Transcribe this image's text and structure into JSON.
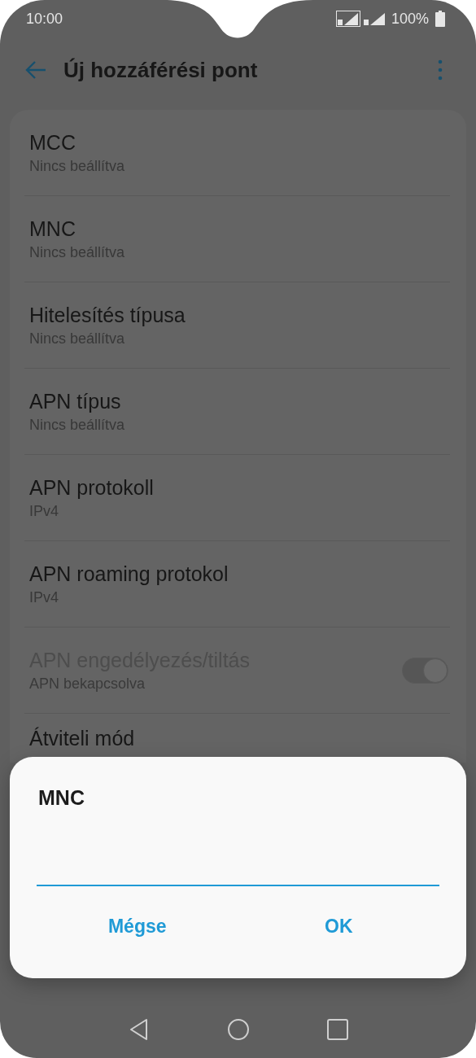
{
  "status_bar": {
    "time": "10:00",
    "battery": "100%"
  },
  "header": {
    "title": "Új hozzáférési pont"
  },
  "settings": [
    {
      "kind": "text",
      "title": "MCC",
      "subtitle": "Nincs beállítva",
      "disabled": false
    },
    {
      "kind": "text",
      "title": "MNC",
      "subtitle": "Nincs beállítva",
      "disabled": false
    },
    {
      "kind": "text",
      "title": "Hitelesítés típusa",
      "subtitle": "Nincs beállítva",
      "disabled": false
    },
    {
      "kind": "text",
      "title": "APN típus",
      "subtitle": "Nincs beállítva",
      "disabled": false
    },
    {
      "kind": "text",
      "title": "APN protokoll",
      "subtitle": "IPv4",
      "disabled": false
    },
    {
      "kind": "text",
      "title": "APN roaming protokol",
      "subtitle": "IPv4",
      "disabled": false
    },
    {
      "kind": "switch",
      "title": "APN engedélyezés/tiltás",
      "subtitle": "APN bekapcsolva",
      "disabled": true,
      "on": true
    },
    {
      "kind": "text",
      "title": "Átviteli mód",
      "disabled": false
    }
  ],
  "dialog": {
    "title": "MNC",
    "buttons": [
      "Mégse",
      "OK"
    ]
  }
}
